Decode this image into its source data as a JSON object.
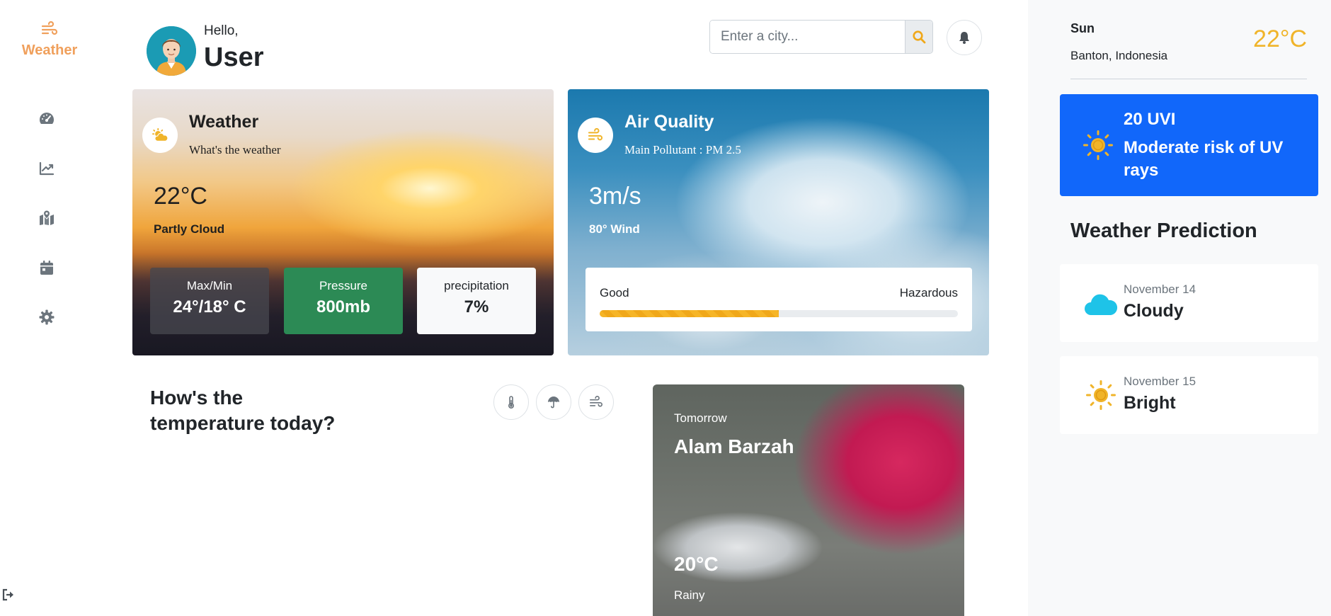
{
  "brand": {
    "label": "Weather",
    "color": "#f0a05c"
  },
  "sidebar": {
    "items": [
      {
        "name": "dashboard",
        "icon": "speedometer-icon"
      },
      {
        "name": "analytics",
        "icon": "chart-line-icon"
      },
      {
        "name": "map",
        "icon": "map-pin-icon"
      },
      {
        "name": "calendar",
        "icon": "calendar-icon"
      },
      {
        "name": "settings",
        "icon": "gear-icon"
      }
    ],
    "logout_icon": "logout-icon"
  },
  "header": {
    "greeting": "Hello,",
    "username": "User",
    "search": {
      "placeholder": "Enter a city...",
      "value": ""
    }
  },
  "weather_card": {
    "title": "Weather",
    "subtitle": "What's the weather",
    "temperature": "22°C",
    "condition": "Partly Cloud",
    "stats": [
      {
        "label": "Max/Min",
        "value": "24°/18° C"
      },
      {
        "label": "Pressure",
        "value": "800mb"
      },
      {
        "label": "precipitation",
        "value": "7%"
      }
    ]
  },
  "air_card": {
    "title": "Air Quality",
    "subtitle": "Main Pollutant : PM 2.5",
    "speed": "3m/s",
    "wind": "80° Wind",
    "scale_low": "Good",
    "scale_high": "Hazardous",
    "level_fraction": 0.5
  },
  "temperature_section": {
    "question_line1": "How's the",
    "question_line2": "temperature today?"
  },
  "tomorrow_card": {
    "label": "Tomorrow",
    "city": "Alam Barzah",
    "temperature": "20°C",
    "condition": "Rainy"
  },
  "right_panel": {
    "day": "Sun",
    "location": "Banton, Indonesia",
    "temperature": "22°C",
    "uv": {
      "value": "20 UVI",
      "description": "Moderate risk of UV rays"
    },
    "heading": "Weather Prediction",
    "predictions": [
      {
        "date": "November 14",
        "condition": "Cloudy",
        "icon": "cloud-icon"
      },
      {
        "date": "November 15",
        "condition": "Bright",
        "icon": "sun-icon"
      }
    ]
  },
  "colors": {
    "accent_orange": "#f0a05c",
    "sun_yellow": "#f0b429",
    "uv_blue": "#1167fa",
    "pressure_green": "#2c8a55",
    "cloud_cyan": "#1ec3e8"
  }
}
